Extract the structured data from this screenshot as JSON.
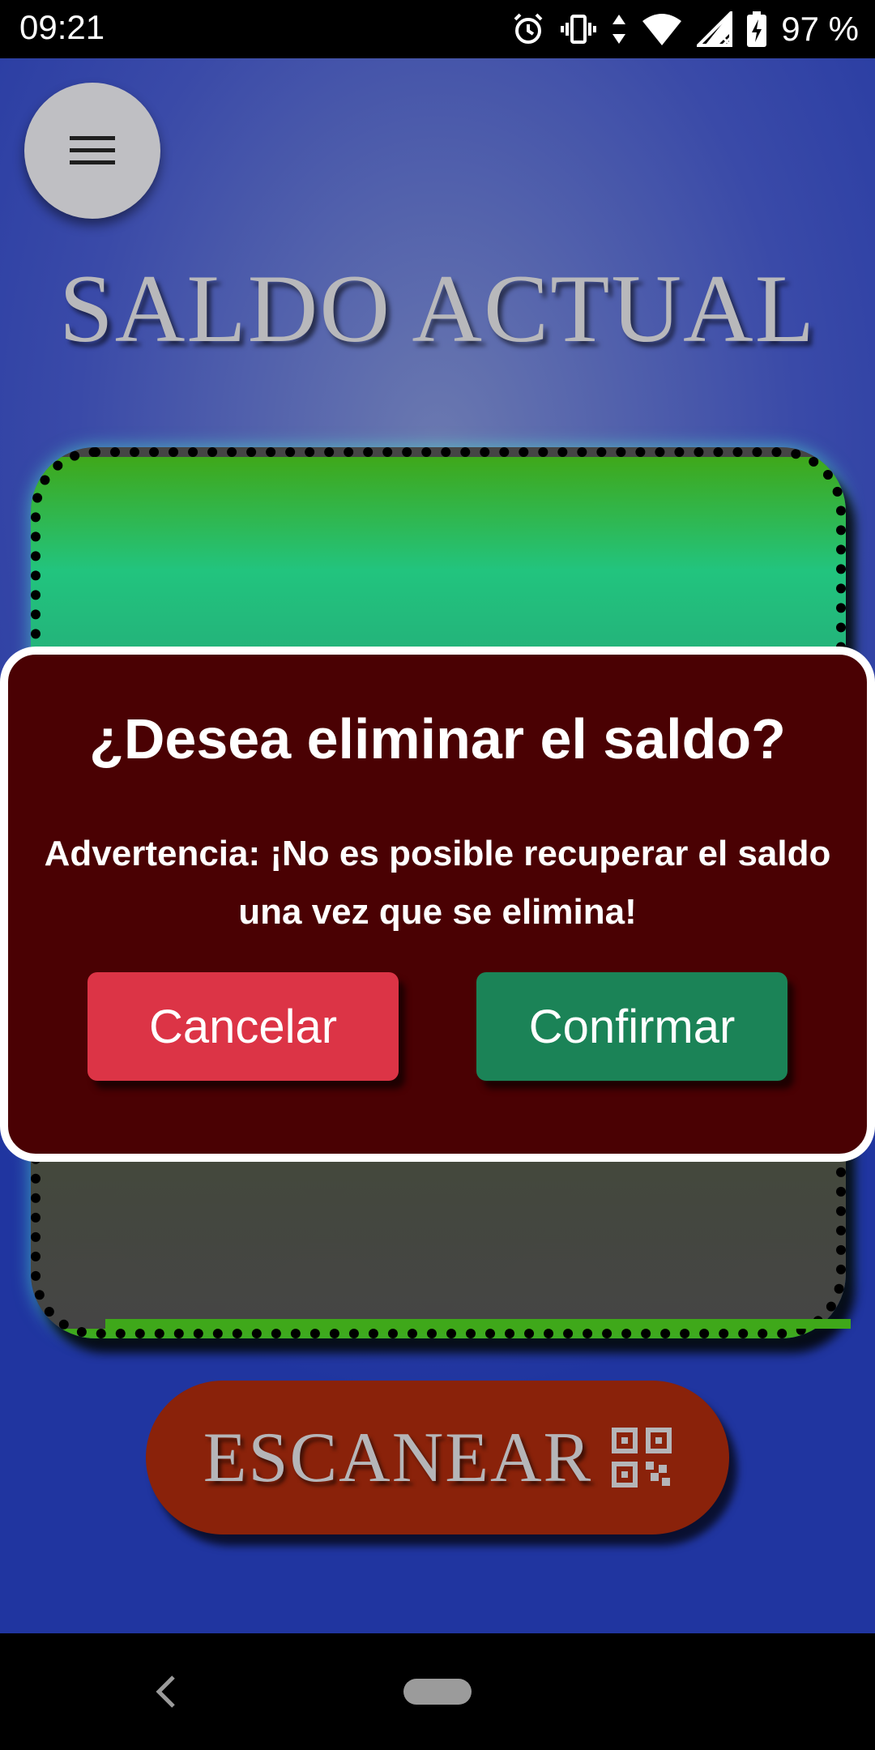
{
  "status_bar": {
    "time": "09:21",
    "battery": "97 %",
    "icons": [
      "alarm-icon",
      "vibrate-icon",
      "data-arrows-icon",
      "wifi-icon",
      "signal-icon",
      "battery-charging-icon"
    ]
  },
  "app": {
    "menu_icon": "hamburger-menu-icon",
    "title": "SALDO ACTUAL",
    "scan_button": {
      "label": "ESCANEAR",
      "icon": "qr-code-icon"
    }
  },
  "dialog": {
    "title": "¿Desea eliminar el saldo?",
    "warning_line1": "Advertencia: ¡No es posible recuperar el saldo",
    "warning_line2": "una vez que se elimina!",
    "cancel_label": "Cancelar",
    "confirm_label": "Confirmar"
  },
  "nav_bar": {
    "back_icon": "back-chevron-icon",
    "home_icon": "home-pill-icon"
  },
  "colors": {
    "background": "#3a4aa8",
    "card_top": "#3fa81a",
    "dialog_bg": "#4a0103",
    "cancel": "#dc3446",
    "confirm": "#1b8357",
    "scan": "#8a220a"
  }
}
